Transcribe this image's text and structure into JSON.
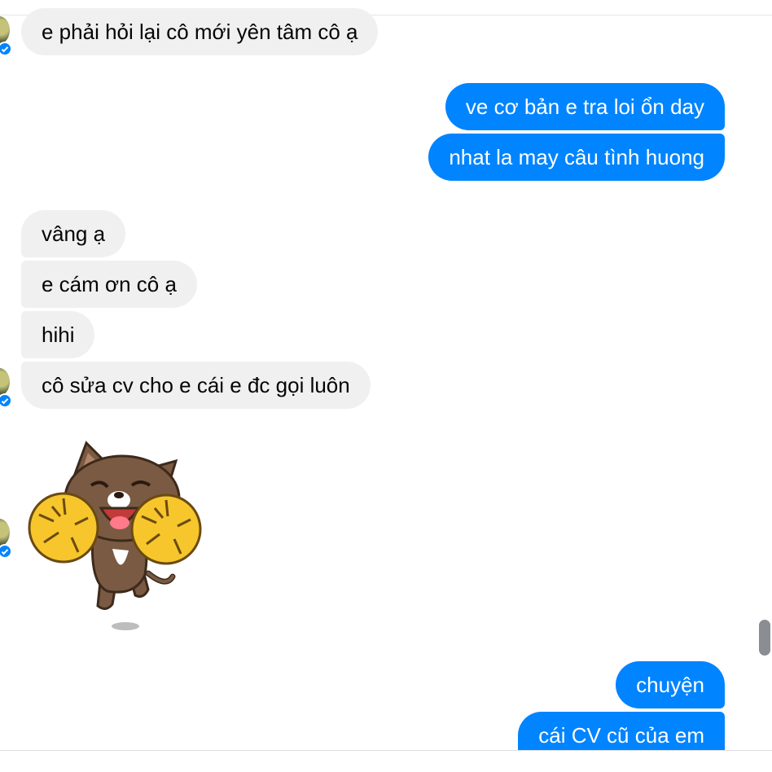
{
  "messages": [
    {
      "direction": "in",
      "text": "e phải hỏi lại cô mới yên tâm cô ạ"
    },
    {
      "direction": "out",
      "text": "ve cơ bản e tra loi ổn day"
    },
    {
      "direction": "out",
      "text": "nhat la may câu tình huong"
    },
    {
      "direction": "in",
      "text": "vâng ạ"
    },
    {
      "direction": "in",
      "text": "e cám ơn cô ạ"
    },
    {
      "direction": "in",
      "text": "hihi"
    },
    {
      "direction": "in",
      "text": "cô sửa cv cho e cái e đc gọi luôn"
    },
    {
      "direction": "out",
      "text": "chuyện"
    },
    {
      "direction": "out",
      "text": "cái CV cũ của em"
    }
  ],
  "sticker": {
    "icon": "cheerleader-cat-sticker-icon"
  },
  "colors": {
    "outgoing": "#0084ff",
    "incoming": "#f0f0f0"
  }
}
